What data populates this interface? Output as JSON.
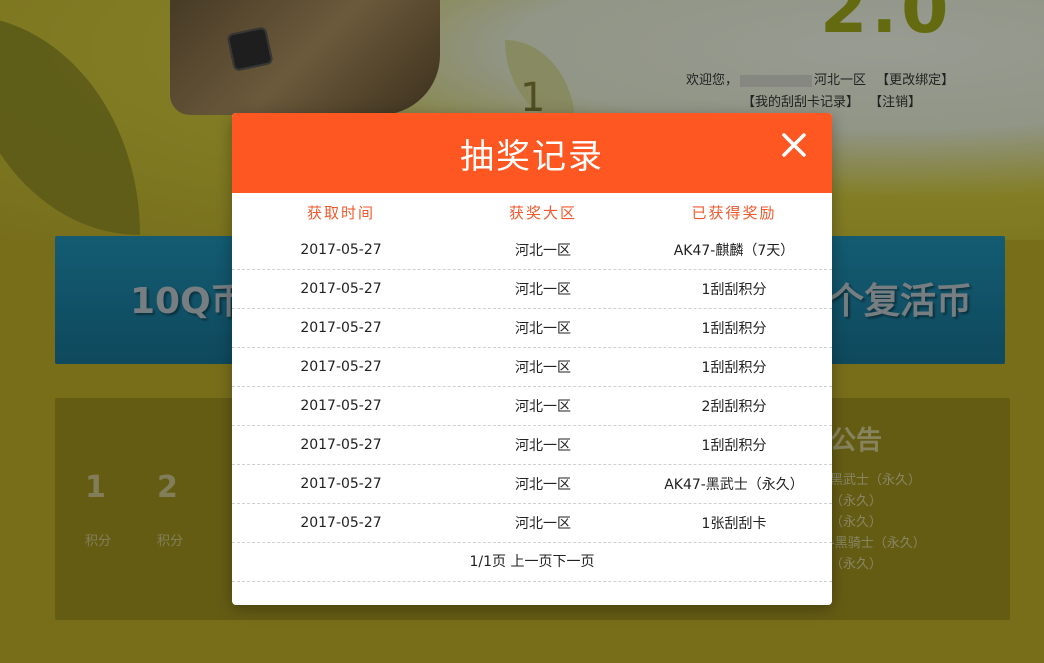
{
  "background": {
    "welcome_prefix": "欢迎您，",
    "region": "河北一区",
    "change_binding": "【更改绑定】",
    "my_records": "【我的刮刮卡记录】",
    "logout": "【注销】",
    "banner_left": "10Q币",
    "banner_right": "个复活币",
    "notice_title": "公告",
    "leaf_number": "1",
    "scores": [
      {
        "value": "1",
        "label": "积分"
      },
      {
        "value": "2",
        "label": "积分"
      }
    ],
    "notice_items": [
      "黑武士（永久）",
      "（永久）",
      "（永久）",
      "-黑骑士（永久）",
      "（永久）"
    ]
  },
  "modal": {
    "title": "抽奖记录",
    "columns": [
      "获取时间",
      "获奖大区",
      "已获得奖励"
    ],
    "rows": [
      {
        "time": "2017-05-27",
        "region": "河北一区",
        "reward": "AK47-麒麟（7天）"
      },
      {
        "time": "2017-05-27",
        "region": "河北一区",
        "reward": "1刮刮积分"
      },
      {
        "time": "2017-05-27",
        "region": "河北一区",
        "reward": "1刮刮积分"
      },
      {
        "time": "2017-05-27",
        "region": "河北一区",
        "reward": "1刮刮积分"
      },
      {
        "time": "2017-05-27",
        "region": "河北一区",
        "reward": "2刮刮积分"
      },
      {
        "time": "2017-05-27",
        "region": "河北一区",
        "reward": "1刮刮积分"
      },
      {
        "time": "2017-05-27",
        "region": "河北一区",
        "reward": "AK47-黑武士（永久）"
      },
      {
        "time": "2017-05-27",
        "region": "河北一区",
        "reward": "1张刮刮卡"
      }
    ],
    "pagination": {
      "page_info": "1/1页",
      "prev": "上一页",
      "next": "下一页"
    }
  },
  "colors": {
    "header": "#ff5722",
    "column_text": "#f0592d"
  }
}
